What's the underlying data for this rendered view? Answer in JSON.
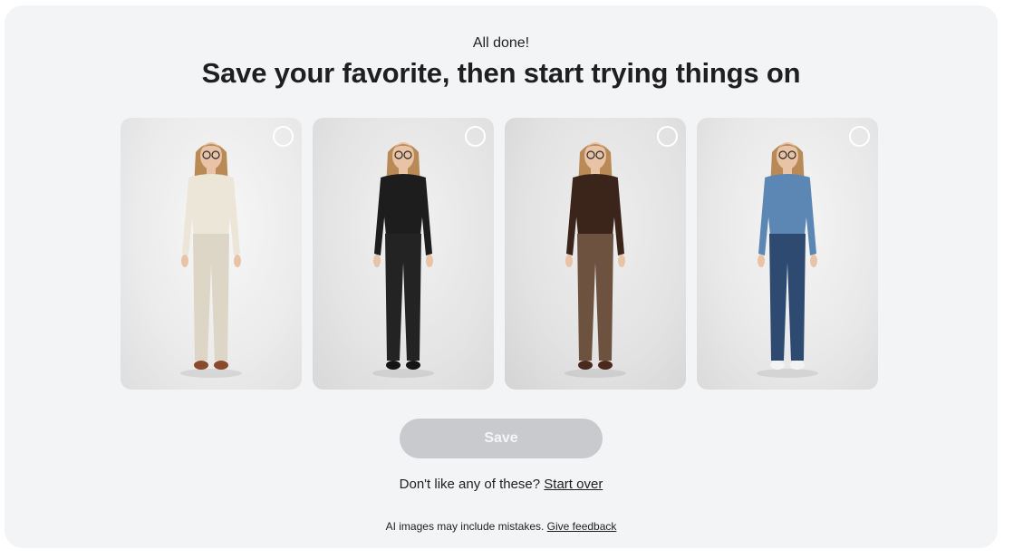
{
  "header": {
    "eyebrow": "All done!",
    "title": "Save your favorite, then start trying things on"
  },
  "outfits": [
    {
      "top_color": "#ece6d8",
      "bottom_color": "#ddd5c5",
      "shoe_color": "#8a4a2e",
      "selected": false
    },
    {
      "top_color": "#1d1d1d",
      "bottom_color": "#232323",
      "shoe_color": "#151515",
      "selected": false
    },
    {
      "top_color": "#3b2419",
      "bottom_color": "#6e5240",
      "shoe_color": "#4a2a1c",
      "selected": false
    },
    {
      "top_color": "#5c86b3",
      "bottom_color": "#2f4a70",
      "shoe_color": "#f3f3f3",
      "selected": false
    }
  ],
  "actions": {
    "save_label": "Save",
    "restart_prompt": "Don't like any of these?",
    "restart_link": "Start over"
  },
  "footer": {
    "disclaimer": "AI images may include mistakes.",
    "feedback_link": "Give feedback"
  }
}
